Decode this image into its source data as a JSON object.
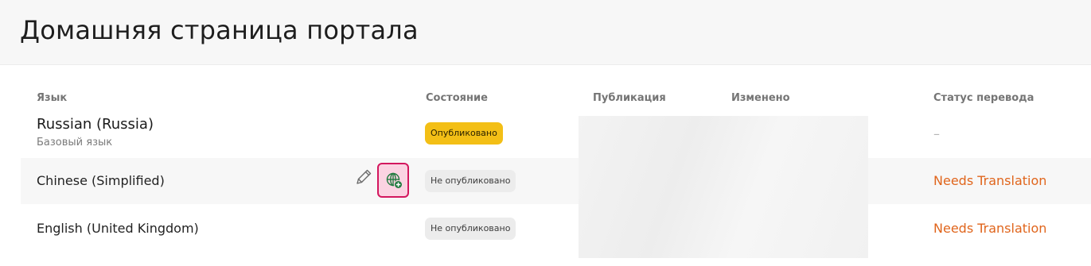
{
  "page": {
    "title": "Домашняя страница портала"
  },
  "table": {
    "columns": {
      "language": "Язык",
      "state": "Состояние",
      "publication": "Публикация",
      "modified": "Изменено",
      "translation_status": "Статус перевода"
    },
    "rows": [
      {
        "language": "Russian (Russia)",
        "sublabel": "Базовый язык",
        "state": "Опубликовано",
        "translation_status": "–"
      },
      {
        "language": "Chinese (Simplified)",
        "state": "Не опубликовано",
        "translation_status": "Needs Translation",
        "actions": [
          "pencil-icon",
          "globe-add-icon"
        ]
      },
      {
        "language": "English (United Kingdom)",
        "state": "Не опубликовано",
        "translation_status": "Needs Translation"
      }
    ]
  },
  "colors": {
    "published_badge": "#f3bf16",
    "unpublished_badge": "#ececec",
    "needs_translation": "#e0651c",
    "highlight_border": "#d3175e",
    "highlight_fill": "#fbd3e2",
    "globe_icon": "#1f7a3e"
  }
}
